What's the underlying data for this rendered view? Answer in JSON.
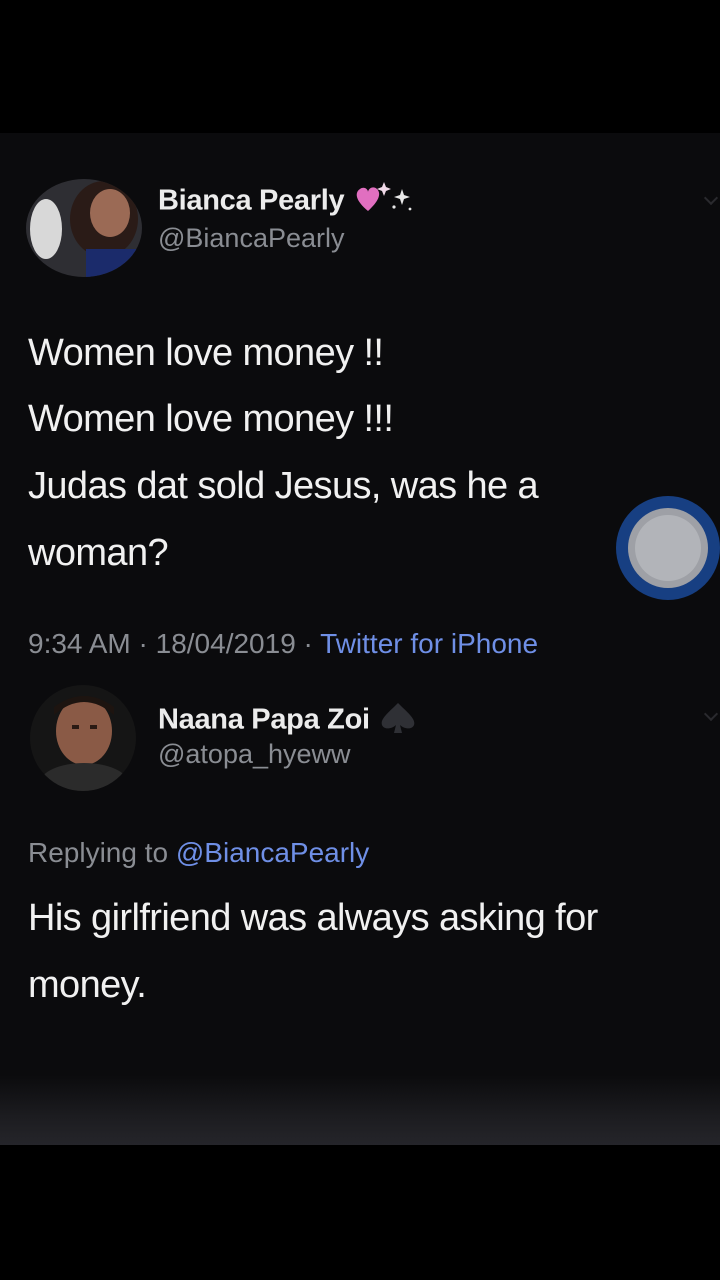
{
  "tweet": {
    "author_name": "Bianca Pearly",
    "author_handle": "@BiancaPearly",
    "lines": [
      "Women love money !!",
      "Women love money !!!",
      "Judas dat sold Jesus, was he a",
      "woman?"
    ],
    "time": "9:34 AM",
    "separator": "·",
    "date": "18/04/2019",
    "source": "Twitter for iPhone"
  },
  "reply": {
    "author_name": "Naana Papa Zoi",
    "author_handle": "@atopa_hyeww",
    "replying_prefix": "Replying to",
    "replying_to": "@BiancaPearly",
    "lines": [
      "His girlfriend was always asking for",
      "money."
    ]
  },
  "icons": {
    "author_badge": "sparkling-heart-sparkles-icon",
    "reply_badge": "spade-icon",
    "floating_button": "assistive-touch-icon"
  },
  "colors": {
    "background": "#000000",
    "link": "#6f8fe6",
    "secondary_text": "#8a8d93",
    "assistive_touch": "#173f82"
  }
}
